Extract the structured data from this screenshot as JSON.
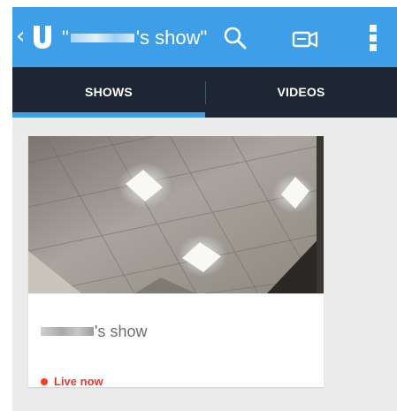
{
  "app": {
    "title_prefix": "\"",
    "title_suffix": "'s show\"",
    "back_icon": "chevron-left-icon",
    "logo": "U",
    "accent_color": "#3f9ee8",
    "tabbar_color": "#1d2733",
    "actions": {
      "search_icon": "search-icon",
      "camera_icon": "video-camera-icon",
      "menu_icon": "overflow-menu-icon"
    }
  },
  "tabs": [
    {
      "label": "SHOWS",
      "selected": true
    },
    {
      "label": "VIDEOS",
      "selected": false
    }
  ],
  "shows": [
    {
      "title_suffix": "'s show",
      "status": "Live now",
      "status_color": "#e53935"
    }
  ]
}
